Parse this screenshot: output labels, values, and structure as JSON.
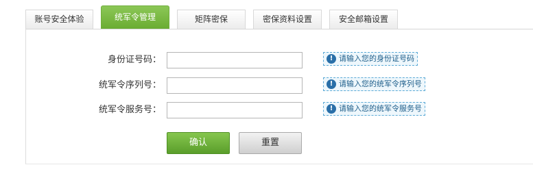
{
  "tabs": [
    {
      "label": "账号安全体验",
      "active": false
    },
    {
      "label": "统军令管理",
      "active": true
    },
    {
      "label": "矩阵密保",
      "active": false
    },
    {
      "label": "密保资料设置",
      "active": false
    },
    {
      "label": "安全邮箱设置",
      "active": false
    }
  ],
  "form": {
    "id_card": {
      "label": "身份证号码：",
      "value": "",
      "hint": "请输入您的身份证号码",
      "hint_icon": "info-icon"
    },
    "serial": {
      "label": "统军令序列号：",
      "value": "",
      "hint": "请输入您的统军令序列号",
      "hint_icon": "info-icon"
    },
    "service": {
      "label": "统军令服务号：",
      "value": "",
      "hint": "请输入您的统军令服务号",
      "hint_icon": "info-icon"
    }
  },
  "buttons": {
    "confirm": "确认",
    "reset": "重置"
  },
  "colors": {
    "active_tab": "#7cbb45",
    "hint_border": "#5aa9d6",
    "confirm_button": "#6aac32"
  }
}
